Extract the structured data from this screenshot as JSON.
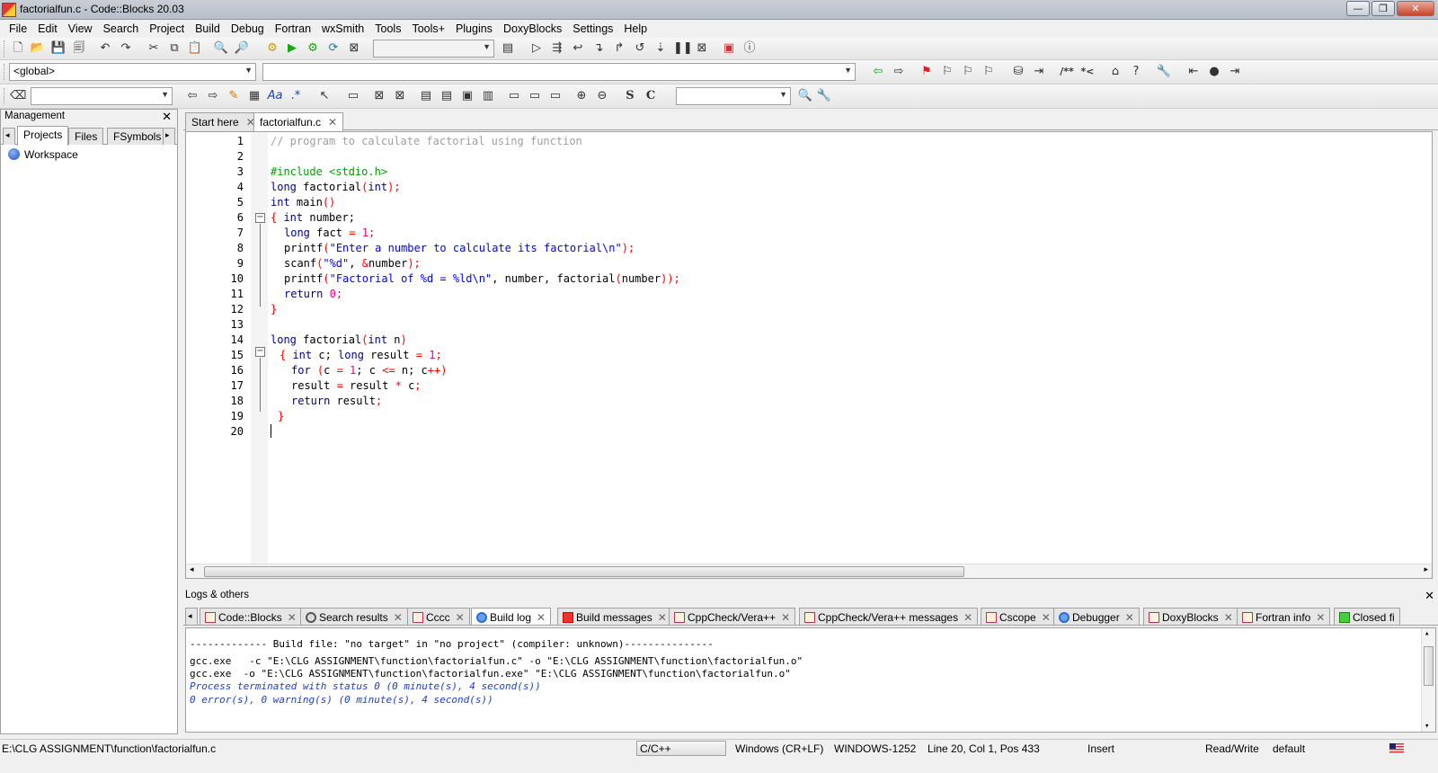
{
  "window": {
    "title": "factorialfun.c - Code::Blocks 20.03"
  },
  "menu": [
    "File",
    "Edit",
    "View",
    "Search",
    "Project",
    "Build",
    "Debug",
    "Fortran",
    "wxSmith",
    "Tools",
    "Tools+",
    "Plugins",
    "DoxyBlocks",
    "Settings",
    "Help"
  ],
  "toolbar": {
    "scope_combo": "<global>",
    "symbol_combo": "",
    "build_target_combo": "",
    "search_combo": "",
    "find_combo": ""
  },
  "management": {
    "title": "Management",
    "tabs": [
      "Projects",
      "Files",
      "FSymbols"
    ],
    "tree_root": "Workspace"
  },
  "editor": {
    "tabs": [
      "Start here",
      "factorialfun.c"
    ],
    "active_tab": "factorialfun.c",
    "line_numbers": [
      "1",
      "2",
      "3",
      "4",
      "5",
      "6",
      "7",
      "8",
      "9",
      "10",
      "11",
      "12",
      "13",
      "14",
      "15",
      "16",
      "17",
      "18",
      "19",
      "20"
    ]
  },
  "logs": {
    "title": "Logs & others",
    "tabs": [
      "Code::Blocks",
      "Search results",
      "Cccc",
      "Build log",
      "Build messages",
      "CppCheck/Vera++",
      "CppCheck/Vera++ messages",
      "Cscope",
      "Debugger",
      "DoxyBlocks",
      "Fortran info",
      "Closed fi"
    ],
    "active_tab": "Build log",
    "lines": [
      "------------- Build file: \"no target\" in \"no project\" (compiler: unknown)---------------",
      "gcc.exe   -c \"E:\\CLG ASSIGNMENT\\function\\factorialfun.c\" -o \"E:\\CLG ASSIGNMENT\\function\\factorialfun.o\"",
      "gcc.exe  -o \"E:\\CLG ASSIGNMENT\\function\\factorialfun.exe\" \"E:\\CLG ASSIGNMENT\\function\\factorialfun.o\"",
      "Process terminated with status 0 (0 minute(s), 4 second(s))",
      "0 error(s), 0 warning(s) (0 minute(s), 4 second(s))"
    ]
  },
  "status": {
    "path": "E:\\CLG ASSIGNMENT\\function\\factorialfun.c",
    "language": "C/C++",
    "eol": "Windows (CR+LF)",
    "encoding": "WINDOWS-1252",
    "position": "Line 20, Col 1, Pos 433",
    "mode": "Insert",
    "access": "Read/Write",
    "profile": "default"
  },
  "code_lines": {
    "l1": "// program to calculate factorial using function",
    "l3": "#include <stdio.h>",
    "l4_kw": "long",
    "l4_rest": " factorial",
    "l4_p": "(",
    "l4_int": "int",
    "l4_p2": ");",
    "l5_kw": "int",
    "l5_rest": " main",
    "l5_p": "()",
    "l6_b": "{",
    "l6_kw": " int",
    "l6_rest": " number;",
    "l7_kw": "long",
    "l7_rest": " fact ",
    "l7_op": "=",
    "l7_num": " 1",
    "l7_end": ";",
    "l8_a": "printf",
    "l8_p": "(",
    "l8_str": "\"Enter a number to calculate its factorial\\n\"",
    "l8_end": ");",
    "l9_a": "scanf",
    "l9_p": "(",
    "l9_str": "\"%d\"",
    "l9_c": ", ",
    "l9_op": "&",
    "l9_b": "number",
    "l9_end": ");",
    "l10_a": "printf",
    "l10_p": "(",
    "l10_str": "\"Factorial of %d = %ld\\n\"",
    "l10_b": ", number, factorial",
    "l10_p2": "(",
    "l10_c": "number",
    "l10_end": "));",
    "l11_kw": "return",
    "l11_num": " 0",
    "l11_end": ";",
    "l12": "}",
    "l14_kw": "long",
    "l14_rest": " factorial",
    "l14_p": "(",
    "l14_int": "int",
    "l14_n": " n",
    "l14_p2": ")",
    "l15_b": "{",
    "l15_kw": " int",
    "l15_c": " c; ",
    "l15_kw2": "long",
    "l15_r": " result ",
    "l15_op": "=",
    "l15_num": " 1",
    "l15_end": ";",
    "l16_kw": "for",
    "l16_p": " (",
    "l16_a": "c ",
    "l16_op": "=",
    "l16_num": " 1",
    "l16_b": "; c ",
    "l16_op2": "<=",
    "l16_c": " n; c",
    "l16_op3": "++",
    "l16_end": ")",
    "l17_a": "result ",
    "l17_op": "=",
    "l17_b": " result ",
    "l17_op2": "*",
    "l17_c": " c",
    "l17_end": ";",
    "l18_kw": "return",
    "l18_b": " result",
    "l18_end": ";",
    "l19": "}"
  }
}
